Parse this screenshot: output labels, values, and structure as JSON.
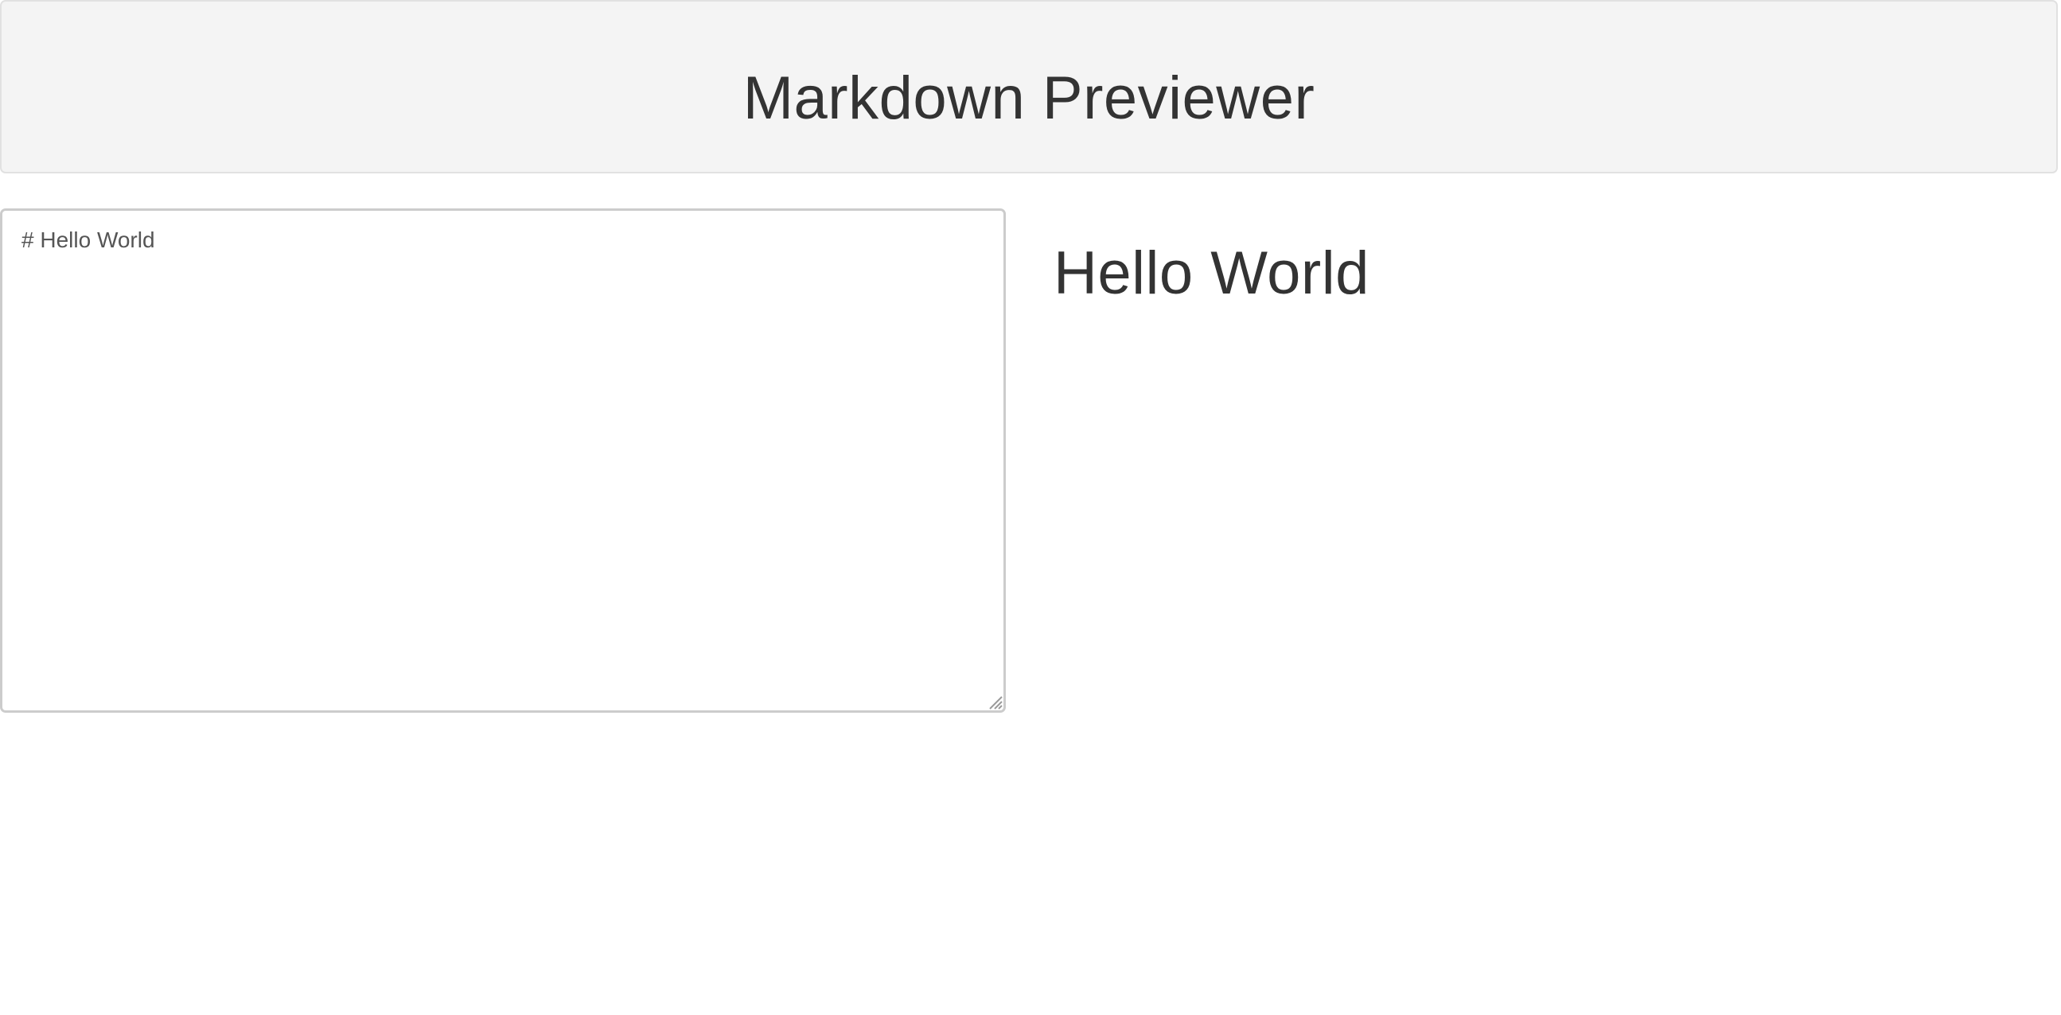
{
  "header": {
    "title": "Markdown Previewer"
  },
  "editor": {
    "value": "# Hello World"
  },
  "preview": {
    "heading": "Hello World"
  },
  "icons": {
    "resize_handle": "resize-grip-icon"
  },
  "colors": {
    "header_background": "#f4f4f4",
    "header_border": "#e1e1e1",
    "text": "#333333",
    "editor_border": "#cccccc"
  }
}
